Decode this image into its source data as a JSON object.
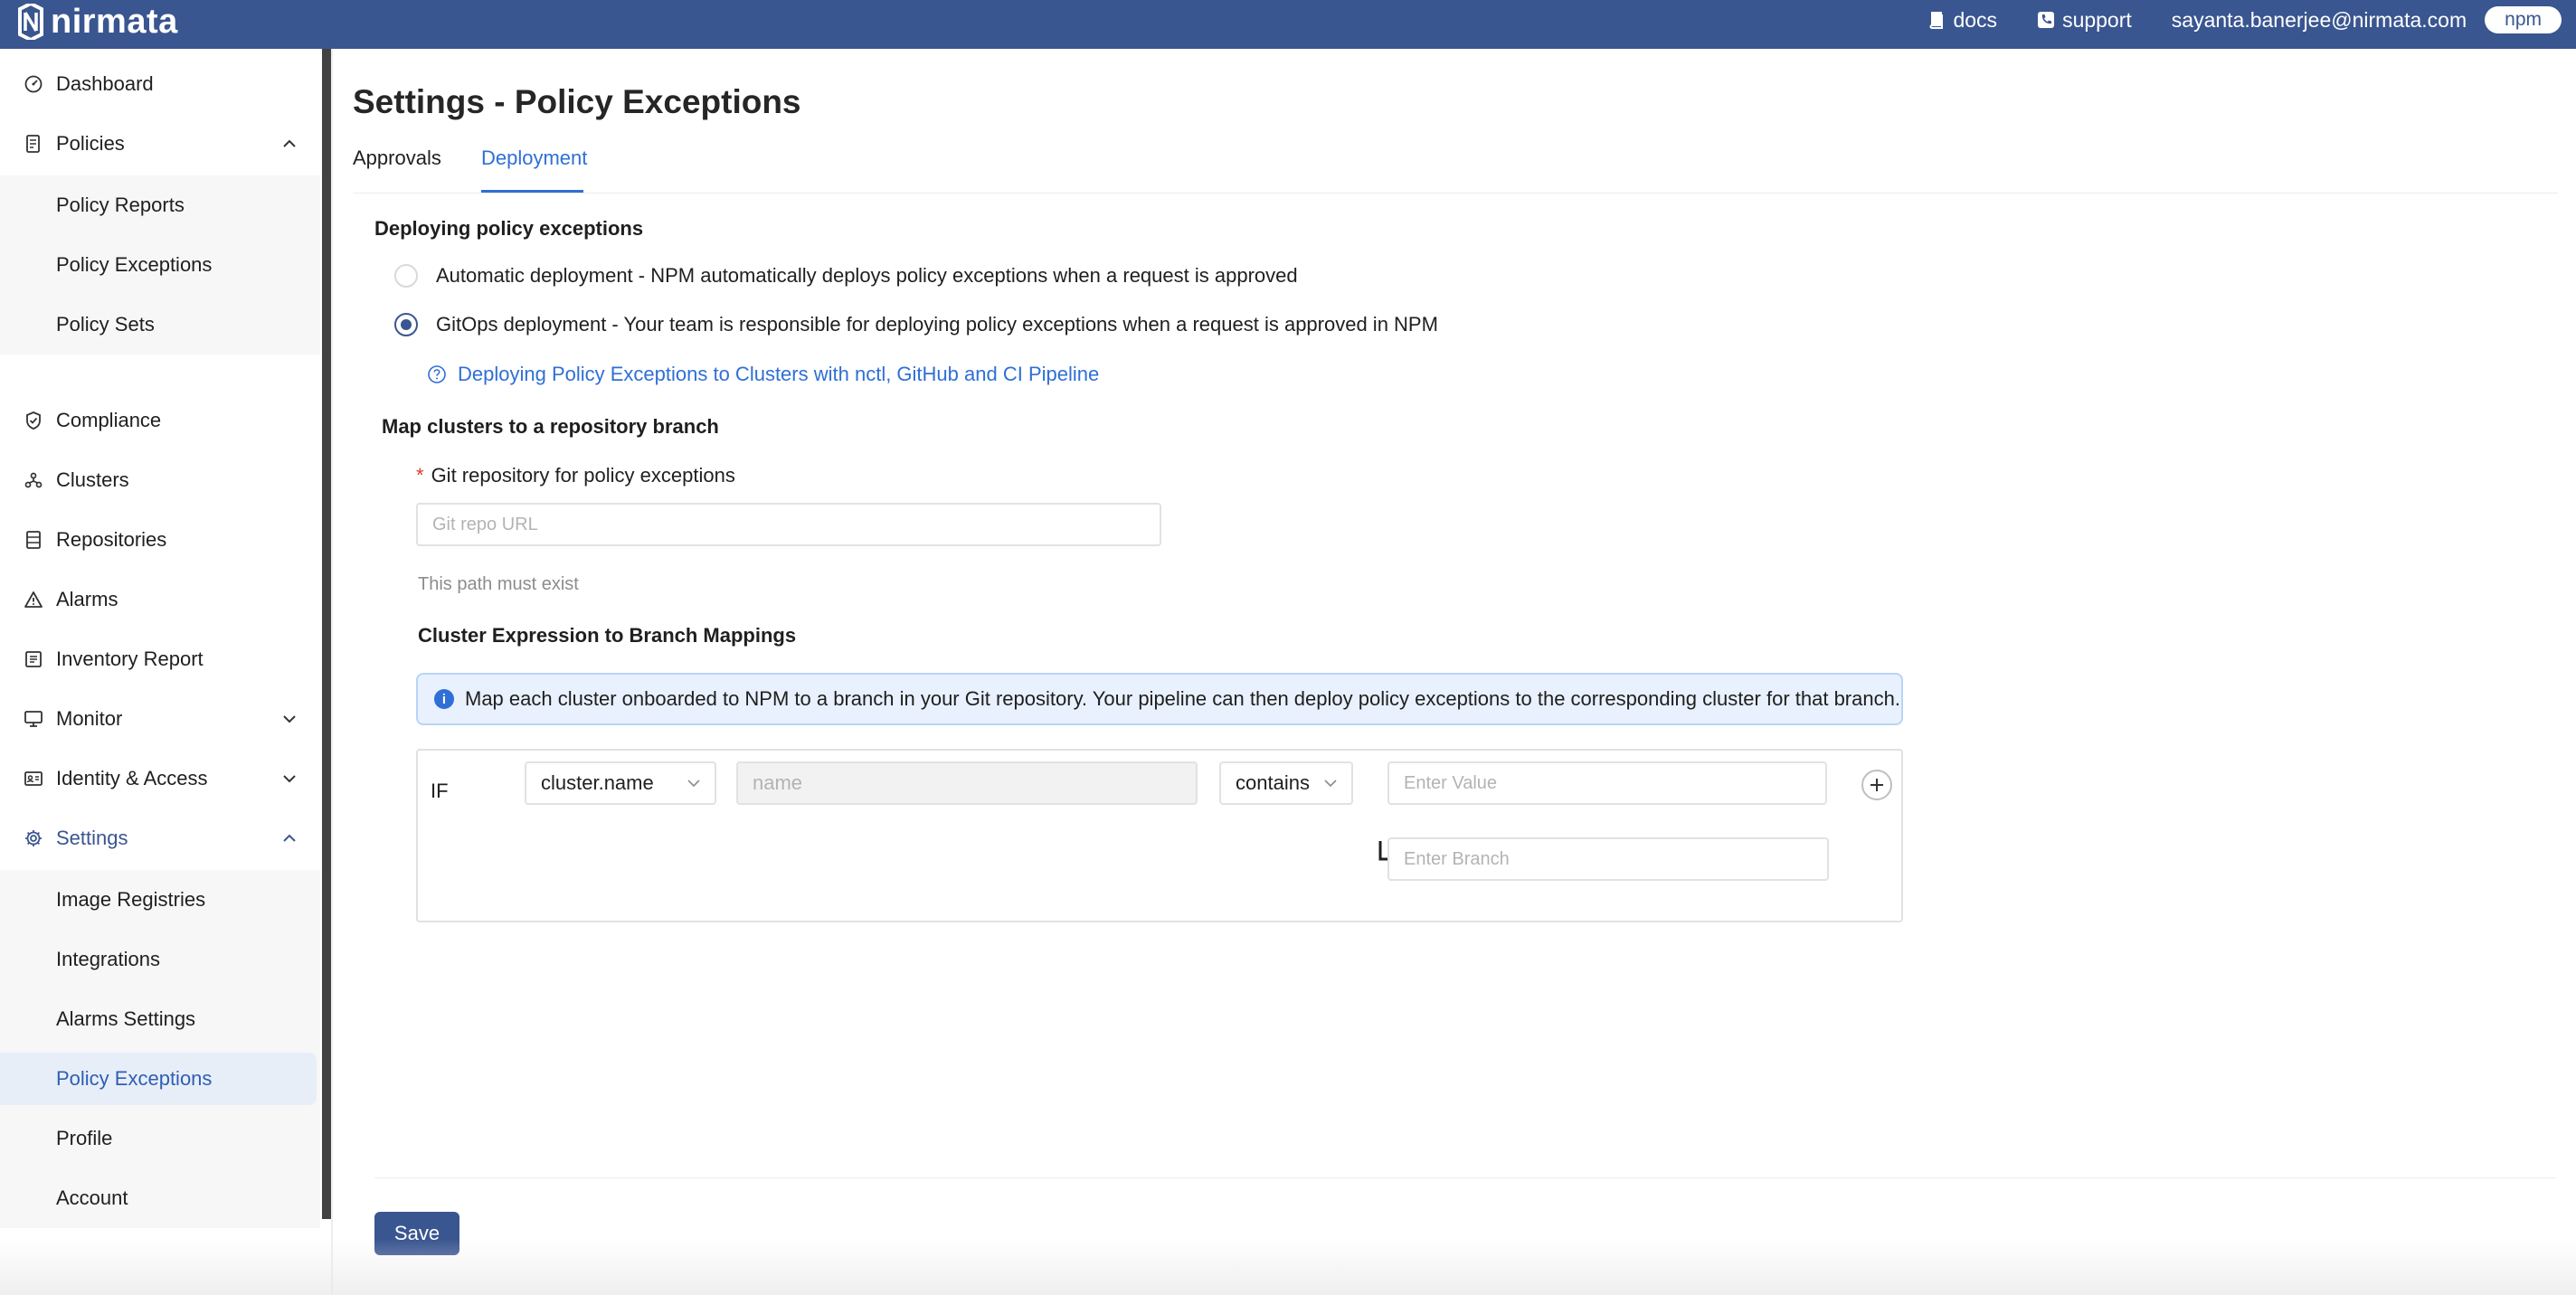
{
  "topbar": {
    "logo_text": "nirmata",
    "docs_label": "docs",
    "support_label": "support",
    "user_email": "sayanta.banerjee@nirmata.com",
    "tenant_badge": "npm",
    "docs_icon": "book-icon",
    "support_icon": "phone-icon"
  },
  "sidebar": {
    "dashboard": "Dashboard",
    "policies": "Policies",
    "policy_reports": "Policy Reports",
    "policy_exceptions": "Policy Exceptions",
    "policy_sets": "Policy Sets",
    "compliance": "Compliance",
    "clusters": "Clusters",
    "repositories": "Repositories",
    "alarms": "Alarms",
    "inventory_report": "Inventory Report",
    "monitor": "Monitor",
    "identity_access": "Identity & Access",
    "settings": "Settings",
    "image_registries": "Image Registries",
    "integrations": "Integrations",
    "alarms_settings": "Alarms Settings",
    "settings_policy_exceptions": "Policy Exceptions",
    "profile": "Profile",
    "account": "Account",
    "selected_item": "Policy Exceptions"
  },
  "main": {
    "title": "Settings - Policy Exceptions",
    "tabs": [
      {
        "label": "Approvals",
        "active": false
      },
      {
        "label": "Deployment",
        "active": true
      }
    ],
    "deploy_section_title": "Deploying policy exceptions",
    "radio_automatic": "Automatic deployment - NPM automatically deploys policy exceptions when a request is approved",
    "radio_gitops": "GitOps deployment - Your team is responsible for deploying policy exceptions when a request is approved in NPM",
    "selected_option": "GitOps deployment",
    "help_link": "Deploying Policy Exceptions to Clusters with nctl, GitHub and CI Pipeline",
    "map_section_title": "Map clusters to a repository branch",
    "git_repo_label": "Git repository for policy exceptions",
    "git_repo_required_mark": "*",
    "git_repo_placeholder": "Git repo URL",
    "git_repo_value": "",
    "path_hint": "This path must exist",
    "mappings_title": "Cluster Expression to Branch Mappings",
    "info_banner": "Map each cluster onboarded to NPM to a branch in your Git repository. Your pipeline can then deploy policy exceptions to the corresponding cluster for that branch.",
    "mapping": {
      "if_label": "IF",
      "field_select": "cluster.name",
      "name_placeholder": "name",
      "operator_select": "contains",
      "value_placeholder": "Enter Value",
      "branch_placeholder": "Enter Branch"
    },
    "save_label": "Save"
  },
  "colors": {
    "brand": "#3a5690",
    "link": "#2f6fd6",
    "info_bg": "#e8f1fd"
  }
}
